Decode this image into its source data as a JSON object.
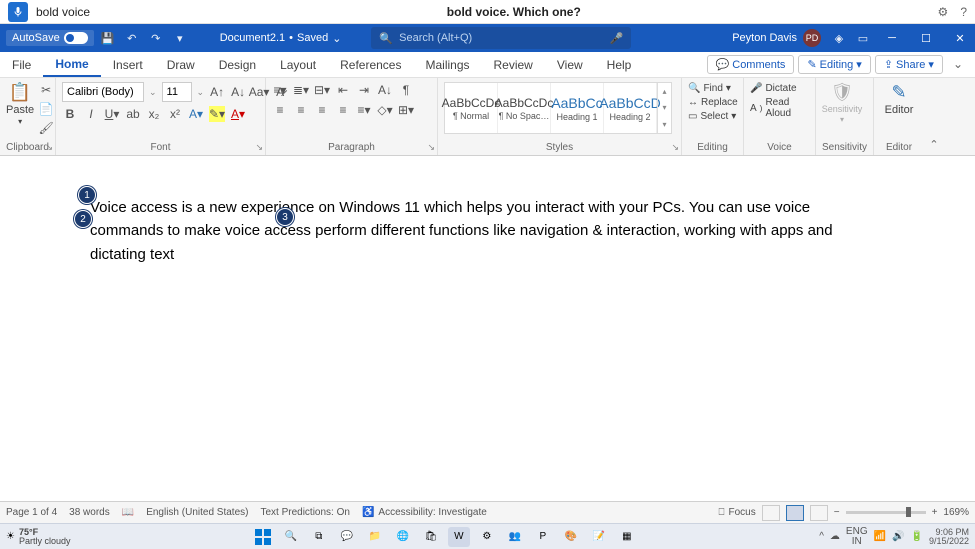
{
  "voice_bar": {
    "command": "bold voice",
    "prompt": "bold voice. Which one?"
  },
  "title_bar": {
    "autosave": "AutoSave",
    "document": "Document2.1",
    "saved_state": "Saved",
    "search_placeholder": "Search (Alt+Q)",
    "user_name": "Peyton Davis",
    "user_initials": "PD"
  },
  "tabs": {
    "items": [
      "File",
      "Home",
      "Insert",
      "Draw",
      "Design",
      "Layout",
      "References",
      "Mailings",
      "Review",
      "View",
      "Help"
    ],
    "active": "Home",
    "comments": "Comments",
    "editing": "Editing",
    "share": "Share"
  },
  "ribbon": {
    "clipboard": {
      "label": "Clipboard",
      "paste": "Paste"
    },
    "font": {
      "label": "Font",
      "family": "Calibri (Body)",
      "size": "11"
    },
    "paragraph": {
      "label": "Paragraph"
    },
    "styles": {
      "label": "Styles",
      "items": [
        {
          "sample": "AaBbCcDc",
          "name": "¶ Normal",
          "cls": ""
        },
        {
          "sample": "AaBbCcDc",
          "name": "¶ No Spac…",
          "cls": ""
        },
        {
          "sample": "AaBbCc",
          "name": "Heading 1",
          "cls": "h1"
        },
        {
          "sample": "AaBbCcD",
          "name": "Heading 2",
          "cls": "h1"
        }
      ]
    },
    "editing": {
      "label": "Editing",
      "find": "Find",
      "replace": "Replace",
      "select": "Select"
    },
    "voice": {
      "label": "Voice",
      "dictate": "Dictate",
      "read_aloud": "Read Aloud"
    },
    "sensitivity": {
      "label": "Sensitivity",
      "btn": "Sensitivity"
    },
    "editor": {
      "label": "Editor",
      "btn": "Editor"
    }
  },
  "badges": {
    "b1": "1",
    "b2": "2",
    "b3": "3"
  },
  "document": {
    "paragraph": "Voice access is a new experience on Windows 11 which helps you interact with your PCs. You can use voice commands to make voice access perform different functions like navigation & interaction, working with apps and dictating text"
  },
  "status": {
    "page": "Page 1 of 4",
    "words": "38 words",
    "language": "English (United States)",
    "predictions": "Text Predictions: On",
    "accessibility": "Accessibility: Investigate",
    "focus": "Focus",
    "zoom": "169%"
  },
  "taskbar": {
    "temp": "75°F",
    "weather": "Partly cloudy",
    "lang": "ENG",
    "locale": "IN",
    "time": "9:06 PM",
    "date": "9/15/2022"
  }
}
